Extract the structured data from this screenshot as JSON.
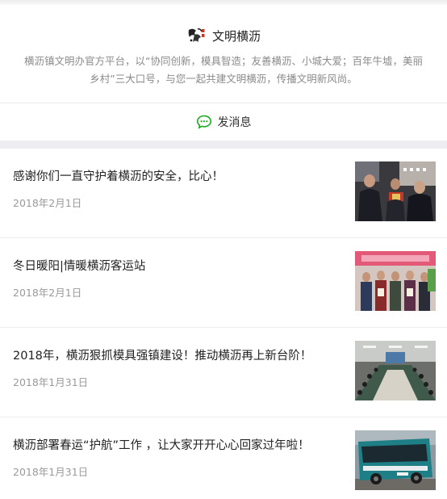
{
  "profile": {
    "name": "文明横沥",
    "description": "横沥镇文明办官方平台，以“协同创新，模具智造；友善横沥、小城大爱；百年牛墟，美丽乡村”三大口号，与您一起共建文明横沥，传播文明新风尚。",
    "avatar_icon": "calligraphy-logo-icon"
  },
  "message": {
    "label": "发消息",
    "icon": "chat-bubble-icon",
    "icon_color": "#1aad19"
  },
  "articles": [
    {
      "title": "感谢你们一直守护着横沥的安全，比心！",
      "date": "2018年2月1日",
      "thumb_icon": "police-ceremony-photo"
    },
    {
      "title": "冬日暖阳|情暖横沥客运站",
      "date": "2018年2月1日",
      "thumb_icon": "group-photo-with-banner"
    },
    {
      "title": "2018年，横沥狠抓模具强镇建设！推动横沥再上新台阶！",
      "date": "2018年1月31日",
      "thumb_icon": "conference-room-photo"
    },
    {
      "title": "横沥部署春运“护航”工作 ，让大家开开心心回家过年啦！",
      "date": "2018年1月31日",
      "thumb_icon": "bus-photo"
    }
  ]
}
